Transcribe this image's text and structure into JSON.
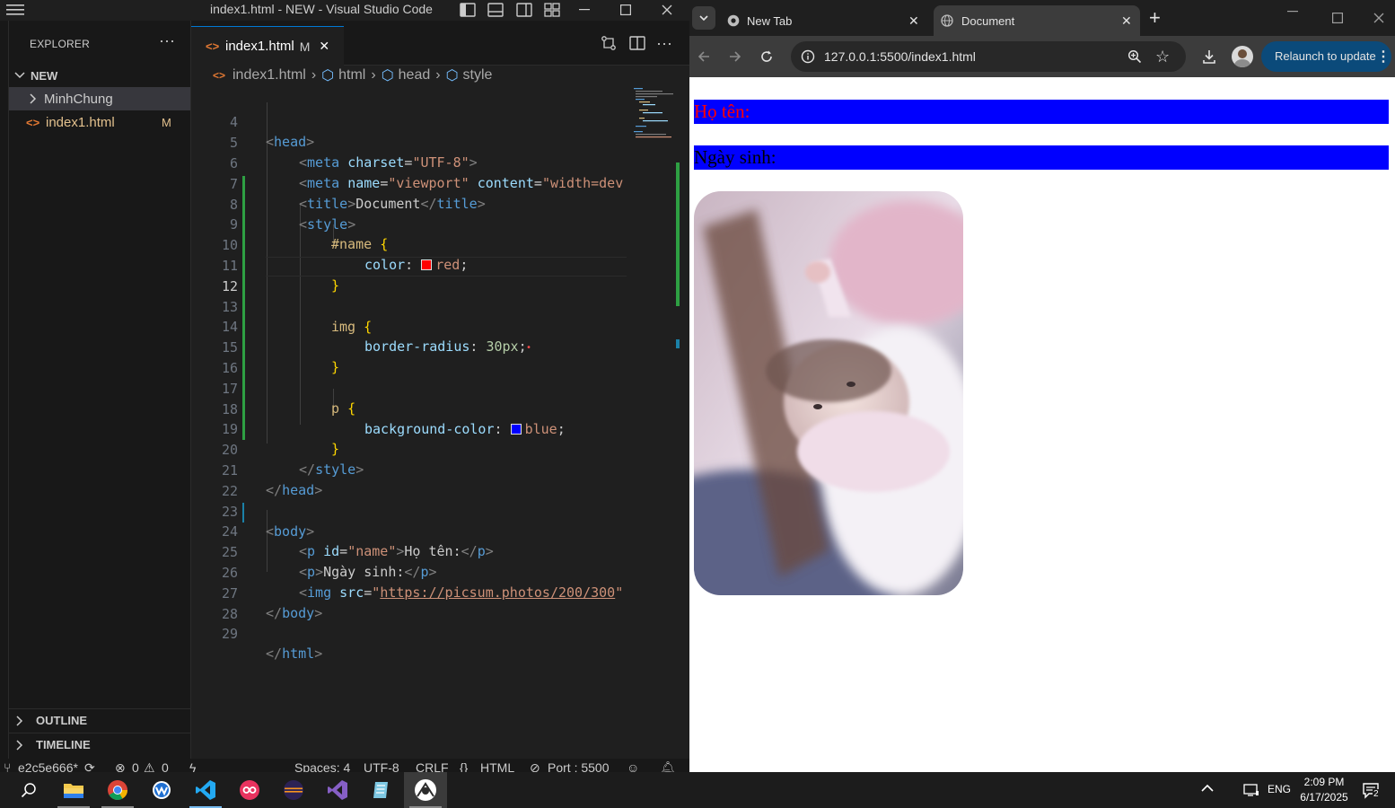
{
  "vscode": {
    "window_title": "index1.html - NEW - Visual Studio Code",
    "explorer": {
      "header": "EXPLORER",
      "more": "···",
      "folder": "NEW",
      "items": [
        {
          "label": "MinhChung",
          "type": "folder",
          "badge": ""
        },
        {
          "label": "index1.html",
          "type": "file",
          "badge": "M"
        }
      ],
      "outline": "OUTLINE",
      "timeline": "TIMELINE"
    },
    "tab": {
      "label": "index1.html",
      "badge": "M",
      "close": "✕"
    },
    "breadcrumb": [
      "index1.html",
      "html",
      "head",
      "style"
    ],
    "code_lines": [
      {
        "n": "4",
        "text": "<head>"
      },
      {
        "n": "5",
        "text": "<meta charset=\"UTF-8\">"
      },
      {
        "n": "6",
        "text": "<meta name=\"viewport\" content=\"width=dev"
      },
      {
        "n": "7",
        "text": "<title>Document</title>"
      },
      {
        "n": "8",
        "text": "<style>"
      },
      {
        "n": "9",
        "text": "#name {"
      },
      {
        "n": "10",
        "text": "color: red;"
      },
      {
        "n": "11",
        "text": "}"
      },
      {
        "n": "12",
        "text": ""
      },
      {
        "n": "13",
        "text": "img {"
      },
      {
        "n": "14",
        "text": "border-radius: 30px;"
      },
      {
        "n": "15",
        "text": "}"
      },
      {
        "n": "16",
        "text": ""
      },
      {
        "n": "17",
        "text": "p {"
      },
      {
        "n": "18",
        "text": "background-color: blue;"
      },
      {
        "n": "19",
        "text": "}"
      },
      {
        "n": "20",
        "text": "</style>"
      },
      {
        "n": "21",
        "text": "</head>"
      },
      {
        "n": "22",
        "text": ""
      },
      {
        "n": "23",
        "text": "<body>"
      },
      {
        "n": "24",
        "text": "<p id=\"name\">Họ tên:</p>"
      },
      {
        "n": "25",
        "text": "<p>Ngày sinh:</p>"
      },
      {
        "n": "26",
        "text": "<img src=\"https://picsum.photos/200/300\""
      },
      {
        "n": "27",
        "text": "</body>"
      },
      {
        "n": "28",
        "text": ""
      },
      {
        "n": "29",
        "text": "</html>"
      }
    ],
    "status": {
      "branch": "e2c5e666*",
      "errors": "0",
      "warnings": "0",
      "spaces": "Spaces: 4",
      "encoding": "UTF-8",
      "eol": "CRLF",
      "language": "HTML",
      "port": "Port : 5500"
    }
  },
  "chrome": {
    "tabs": [
      {
        "label": "New Tab",
        "active": false
      },
      {
        "label": "Document",
        "active": true
      }
    ],
    "url": "127.0.0.1:5500/index1.html",
    "relaunch": "Relaunch to update",
    "page": {
      "name_text": "Họ tên:",
      "dob_text": "Ngày sinh:",
      "name_color": "#ff0000",
      "p_background": "#0000ff"
    }
  },
  "taskbar": {
    "lang": "ENG",
    "time": "2:09 PM",
    "date": "6/17/2025",
    "notifications": "2"
  }
}
